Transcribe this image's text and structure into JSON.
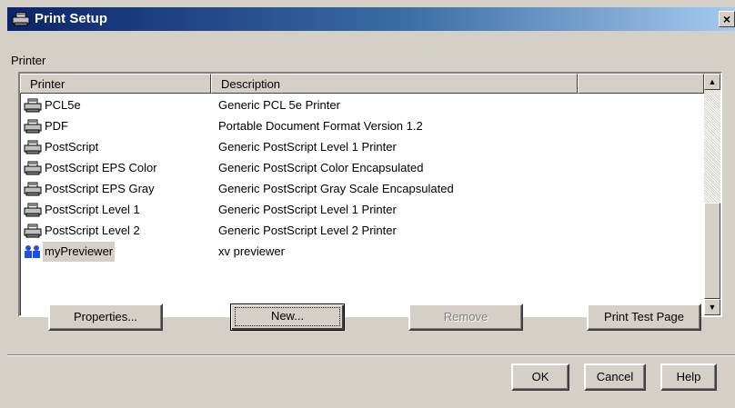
{
  "window": {
    "title": "Print Setup",
    "close_label": "×",
    "icon": "printer-icon"
  },
  "group_label": "Printer",
  "list": {
    "columns": [
      "Printer",
      "Description",
      ""
    ],
    "rows": [
      {
        "name": "PCL5e",
        "description": "Generic PCL 5e Printer",
        "icon": "printer-icon"
      },
      {
        "name": "PDF",
        "description": "Portable Document Format Version 1.2",
        "icon": "printer-icon"
      },
      {
        "name": "PostScript",
        "description": "Generic PostScript Level 1 Printer",
        "icon": "printer-icon"
      },
      {
        "name": "PostScript EPS Color",
        "description": "Generic PostScript Color Encapsulated",
        "icon": "printer-icon"
      },
      {
        "name": "PostScript EPS Gray",
        "description": "Generic PostScript Gray Scale Encapsulated",
        "icon": "printer-icon"
      },
      {
        "name": "PostScript Level 1",
        "description": "Generic PostScript Level 1 Printer",
        "icon": "printer-icon"
      },
      {
        "name": "PostScript Level 2",
        "description": "Generic PostScript Level 2 Printer",
        "icon": "printer-icon"
      },
      {
        "name": "myPreviewer",
        "description": "xv previewer",
        "icon": "users-icon",
        "selected": true
      }
    ]
  },
  "buttons": {
    "properties": "Properties...",
    "new": "New...",
    "remove": "Remove",
    "print_test_page": "Print Test Page",
    "ok": "OK",
    "cancel": "Cancel",
    "help": "Help"
  },
  "colors": {
    "dialog_bg": "#d4d0c8",
    "title_start": "#0a246a",
    "title_end": "#a6caf0",
    "selection_bg": "#d4d0c8"
  }
}
